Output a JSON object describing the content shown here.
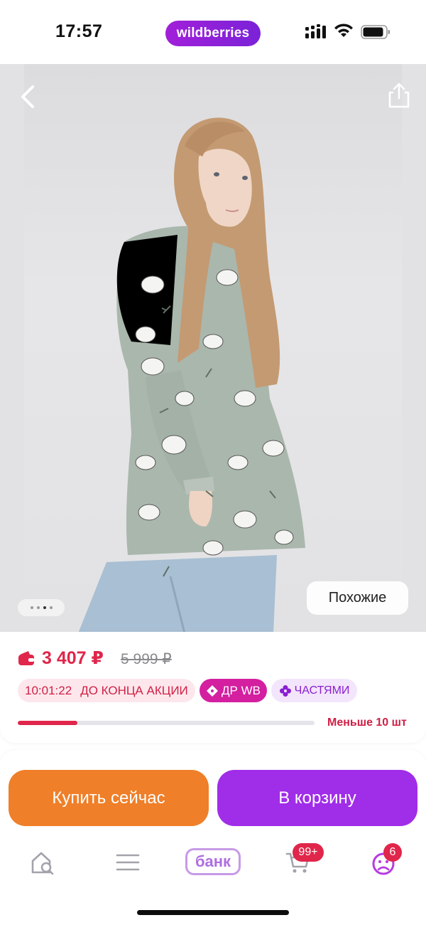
{
  "status_bar": {
    "time": "17:57",
    "brand": "wildberries"
  },
  "hero": {
    "similar_label": "Похожие",
    "slides_total": 4,
    "slide_active": 3
  },
  "price": {
    "current": "3 407 ₽",
    "old": "5 999 ₽",
    "timer": "10:01:22",
    "timer_caption": "ДО КОНЦА АКЦИИ",
    "promo_label": "ДР WB",
    "installments_label": "ЧАСТЯМИ",
    "stock_text": "Меньше 10 шт",
    "stock_fraction": 0.2
  },
  "actions": {
    "buy_now": "Купить сейчас",
    "to_cart": "В корзину"
  },
  "tabbar": {
    "bank_label": "банк",
    "cart_badge": "99+",
    "profile_badge": "6"
  },
  "colors": {
    "brand_gradient": [
      "#a120d9",
      "#7b22d8"
    ],
    "price_red": "#e0264a",
    "buy_orange": "#ef7f28",
    "cart_purple": "#a02de8"
  }
}
